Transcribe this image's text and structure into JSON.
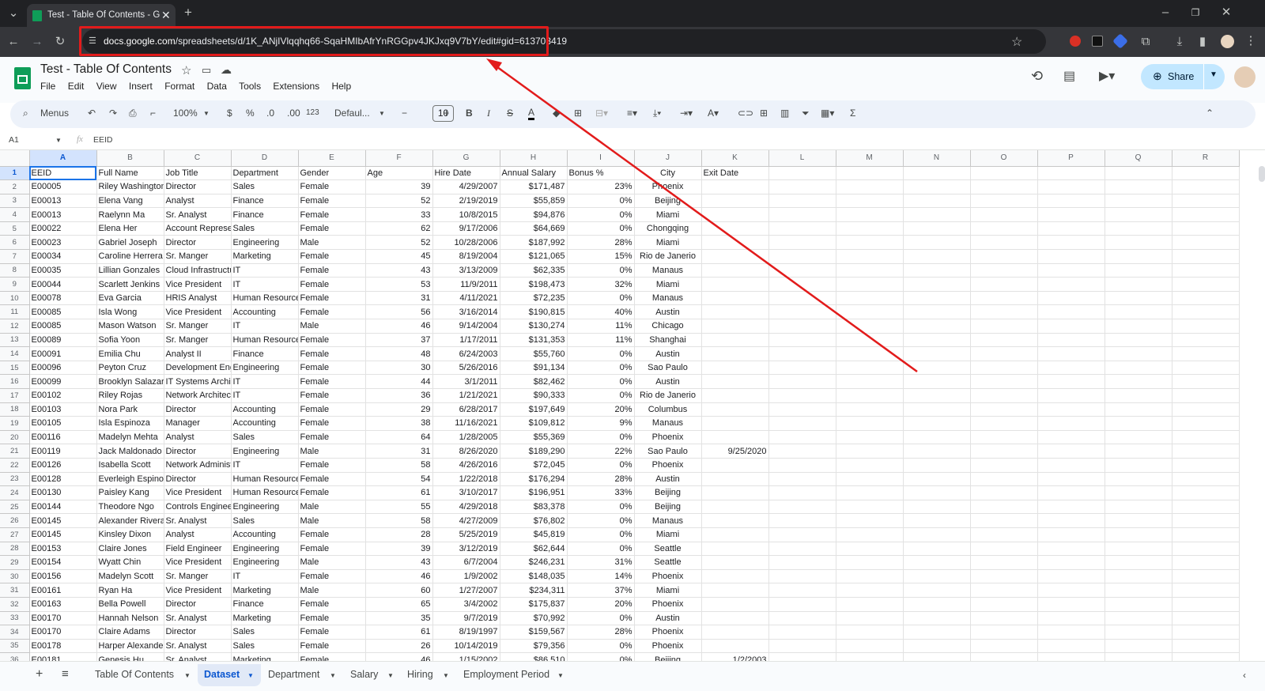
{
  "browser": {
    "tab_title": "Test - Table Of Contents - Goog",
    "url_host": "docs.google.com",
    "url_path": "/spreadsheets/d/1K_ANjIVlqqhq66-SqaHMIbAfrYnRGGpv4JKJxq9V7bY/edit#gid=613703419"
  },
  "sheets": {
    "doc_title": "Test - Table Of Contents",
    "menus": [
      "File",
      "Edit",
      "View",
      "Insert",
      "Format",
      "Data",
      "Tools",
      "Extensions",
      "Help"
    ],
    "share_label": "Share",
    "toolbar": {
      "search_label": "Menus",
      "zoom": "100%",
      "currency": "$",
      "percent": "%",
      "dec_less": ".0",
      "dec_more": ".00",
      "num_format": "123",
      "font": "Defaul...",
      "font_size": "10"
    },
    "name_box": "A1",
    "formula_value": "EEID"
  },
  "grid": {
    "columns": [
      "A",
      "B",
      "C",
      "D",
      "E",
      "F",
      "G",
      "H",
      "I",
      "J",
      "K",
      "L",
      "M",
      "N",
      "O",
      "P",
      "Q",
      "R"
    ],
    "headers": [
      "EEID",
      "Full Name",
      "Job Title",
      "Department",
      "Gender",
      "Age",
      "Hire Date",
      "Annual Salary",
      "Bonus %",
      "City",
      "Exit Date"
    ],
    "rows": [
      [
        "E00005",
        "Riley Washington",
        "Director",
        "Sales",
        "Female",
        "39",
        "4/29/2007",
        "$171,487",
        "23%",
        "Phoenix",
        ""
      ],
      [
        "E00013",
        "Elena Vang",
        "Analyst",
        "Finance",
        "Female",
        "52",
        "2/19/2019",
        "$55,859",
        "0%",
        "Beijing",
        ""
      ],
      [
        "E00013",
        "Raelynn Ma",
        "Sr. Analyst",
        "Finance",
        "Female",
        "33",
        "10/8/2015",
        "$94,876",
        "0%",
        "Miami",
        ""
      ],
      [
        "E00022",
        "Elena Her",
        "Account Representative",
        "Sales",
        "Female",
        "62",
        "9/17/2006",
        "$64,669",
        "0%",
        "Chongqing",
        ""
      ],
      [
        "E00023",
        "Gabriel Joseph",
        "Director",
        "Engineering",
        "Male",
        "52",
        "10/28/2006",
        "$187,992",
        "28%",
        "Miami",
        ""
      ],
      [
        "E00034",
        "Caroline Herrera",
        "Sr. Manger",
        "Marketing",
        "Female",
        "45",
        "8/19/2004",
        "$121,065",
        "15%",
        "Rio de Janerio",
        ""
      ],
      [
        "E00035",
        "Lillian Gonzales",
        "Cloud Infrastructure Architect",
        "IT",
        "Female",
        "43",
        "3/13/2009",
        "$62,335",
        "0%",
        "Manaus",
        ""
      ],
      [
        "E00044",
        "Scarlett Jenkins",
        "Vice President",
        "IT",
        "Female",
        "53",
        "11/9/2011",
        "$198,473",
        "32%",
        "Miami",
        ""
      ],
      [
        "E00078",
        "Eva Garcia",
        "HRIS Analyst",
        "Human Resources",
        "Female",
        "31",
        "4/11/2021",
        "$72,235",
        "0%",
        "Manaus",
        ""
      ],
      [
        "E00085",
        "Isla Wong",
        "Vice President",
        "Accounting",
        "Female",
        "56",
        "3/16/2014",
        "$190,815",
        "40%",
        "Austin",
        ""
      ],
      [
        "E00085",
        "Mason Watson",
        "Sr. Manger",
        "IT",
        "Male",
        "46",
        "9/14/2004",
        "$130,274",
        "11%",
        "Chicago",
        ""
      ],
      [
        "E00089",
        "Sofia Yoon",
        "Sr. Manger",
        "Human Resources",
        "Female",
        "37",
        "1/17/2011",
        "$131,353",
        "11%",
        "Shanghai",
        ""
      ],
      [
        "E00091",
        "Emilia Chu",
        "Analyst II",
        "Finance",
        "Female",
        "48",
        "6/24/2003",
        "$55,760",
        "0%",
        "Austin",
        ""
      ],
      [
        "E00096",
        "Peyton Cruz",
        "Development Engineer",
        "Engineering",
        "Female",
        "30",
        "5/26/2016",
        "$91,134",
        "0%",
        "Sao Paulo",
        ""
      ],
      [
        "E00099",
        "Brooklyn Salazar",
        "IT Systems Architect",
        "IT",
        "Female",
        "44",
        "3/1/2011",
        "$82,462",
        "0%",
        "Austin",
        ""
      ],
      [
        "E00102",
        "Riley Rojas",
        "Network Architect",
        "IT",
        "Female",
        "36",
        "1/21/2021",
        "$90,333",
        "0%",
        "Rio de Janerio",
        ""
      ],
      [
        "E00103",
        "Nora Park",
        "Director",
        "Accounting",
        "Female",
        "29",
        "6/28/2017",
        "$197,649",
        "20%",
        "Columbus",
        ""
      ],
      [
        "E00105",
        "Isla Espinoza",
        "Manager",
        "Accounting",
        "Female",
        "38",
        "11/16/2021",
        "$109,812",
        "9%",
        "Manaus",
        ""
      ],
      [
        "E00116",
        "Madelyn Mehta",
        "Analyst",
        "Sales",
        "Female",
        "64",
        "1/28/2005",
        "$55,369",
        "0%",
        "Phoenix",
        ""
      ],
      [
        "E00119",
        "Jack Maldonado",
        "Director",
        "Engineering",
        "Male",
        "31",
        "8/26/2020",
        "$189,290",
        "22%",
        "Sao Paulo",
        "9/25/2020"
      ],
      [
        "E00126",
        "Isabella Scott",
        "Network Administrator",
        "IT",
        "Female",
        "58",
        "4/26/2016",
        "$72,045",
        "0%",
        "Phoenix",
        ""
      ],
      [
        "E00128",
        "Everleigh Espinoza",
        "Director",
        "Human Resources",
        "Female",
        "54",
        "1/22/2018",
        "$176,294",
        "28%",
        "Austin",
        ""
      ],
      [
        "E00130",
        "Paisley Kang",
        "Vice President",
        "Human Resources",
        "Female",
        "61",
        "3/10/2017",
        "$196,951",
        "33%",
        "Beijing",
        ""
      ],
      [
        "E00144",
        "Theodore Ngo",
        "Controls Engineer",
        "Engineering",
        "Male",
        "55",
        "4/29/2018",
        "$83,378",
        "0%",
        "Beijing",
        ""
      ],
      [
        "E00145",
        "Alexander Rivera",
        "Sr. Analyst",
        "Sales",
        "Male",
        "58",
        "4/27/2009",
        "$76,802",
        "0%",
        "Manaus",
        ""
      ],
      [
        "E00145",
        "Kinsley Dixon",
        "Analyst",
        "Accounting",
        "Female",
        "28",
        "5/25/2019",
        "$45,819",
        "0%",
        "Miami",
        ""
      ],
      [
        "E00153",
        "Claire Jones",
        "Field Engineer",
        "Engineering",
        "Female",
        "39",
        "3/12/2019",
        "$62,644",
        "0%",
        "Seattle",
        ""
      ],
      [
        "E00154",
        "Wyatt Chin",
        "Vice President",
        "Engineering",
        "Male",
        "43",
        "6/7/2004",
        "$246,231",
        "31%",
        "Seattle",
        ""
      ],
      [
        "E00156",
        "Madelyn Scott",
        "Sr. Manger",
        "IT",
        "Female",
        "46",
        "1/9/2002",
        "$148,035",
        "14%",
        "Phoenix",
        ""
      ],
      [
        "E00161",
        "Ryan Ha",
        "Vice President",
        "Marketing",
        "Male",
        "60",
        "1/27/2007",
        "$234,311",
        "37%",
        "Miami",
        ""
      ],
      [
        "E00163",
        "Bella Powell",
        "Director",
        "Finance",
        "Female",
        "65",
        "3/4/2002",
        "$175,837",
        "20%",
        "Phoenix",
        ""
      ],
      [
        "E00170",
        "Hannah Nelson",
        "Sr. Analyst",
        "Marketing",
        "Female",
        "35",
        "9/7/2019",
        "$70,992",
        "0%",
        "Austin",
        ""
      ],
      [
        "E00170",
        "Claire Adams",
        "Director",
        "Sales",
        "Female",
        "61",
        "8/19/1997",
        "$159,567",
        "28%",
        "Phoenix",
        ""
      ],
      [
        "E00178",
        "Harper Alexander",
        "Sr. Analyst",
        "Sales",
        "Female",
        "26",
        "10/14/2019",
        "$79,356",
        "0%",
        "Phoenix",
        ""
      ],
      [
        "E00181",
        "Genesis Hu",
        "Sr. Analyst",
        "Marketing",
        "Female",
        "46",
        "1/15/2002",
        "$86,510",
        "0%",
        "Beijing",
        "1/2/2003"
      ]
    ]
  },
  "sheet_tabs": [
    {
      "label": "Table Of Contents",
      "active": false
    },
    {
      "label": "Dataset",
      "active": true
    },
    {
      "label": "Department",
      "active": false
    },
    {
      "label": "Salary",
      "active": false
    },
    {
      "label": "Hiring",
      "active": false
    },
    {
      "label": "Employment Period",
      "active": false
    }
  ],
  "colors": {
    "annotation": "#e21b1b",
    "accent": "#1a73e8"
  }
}
